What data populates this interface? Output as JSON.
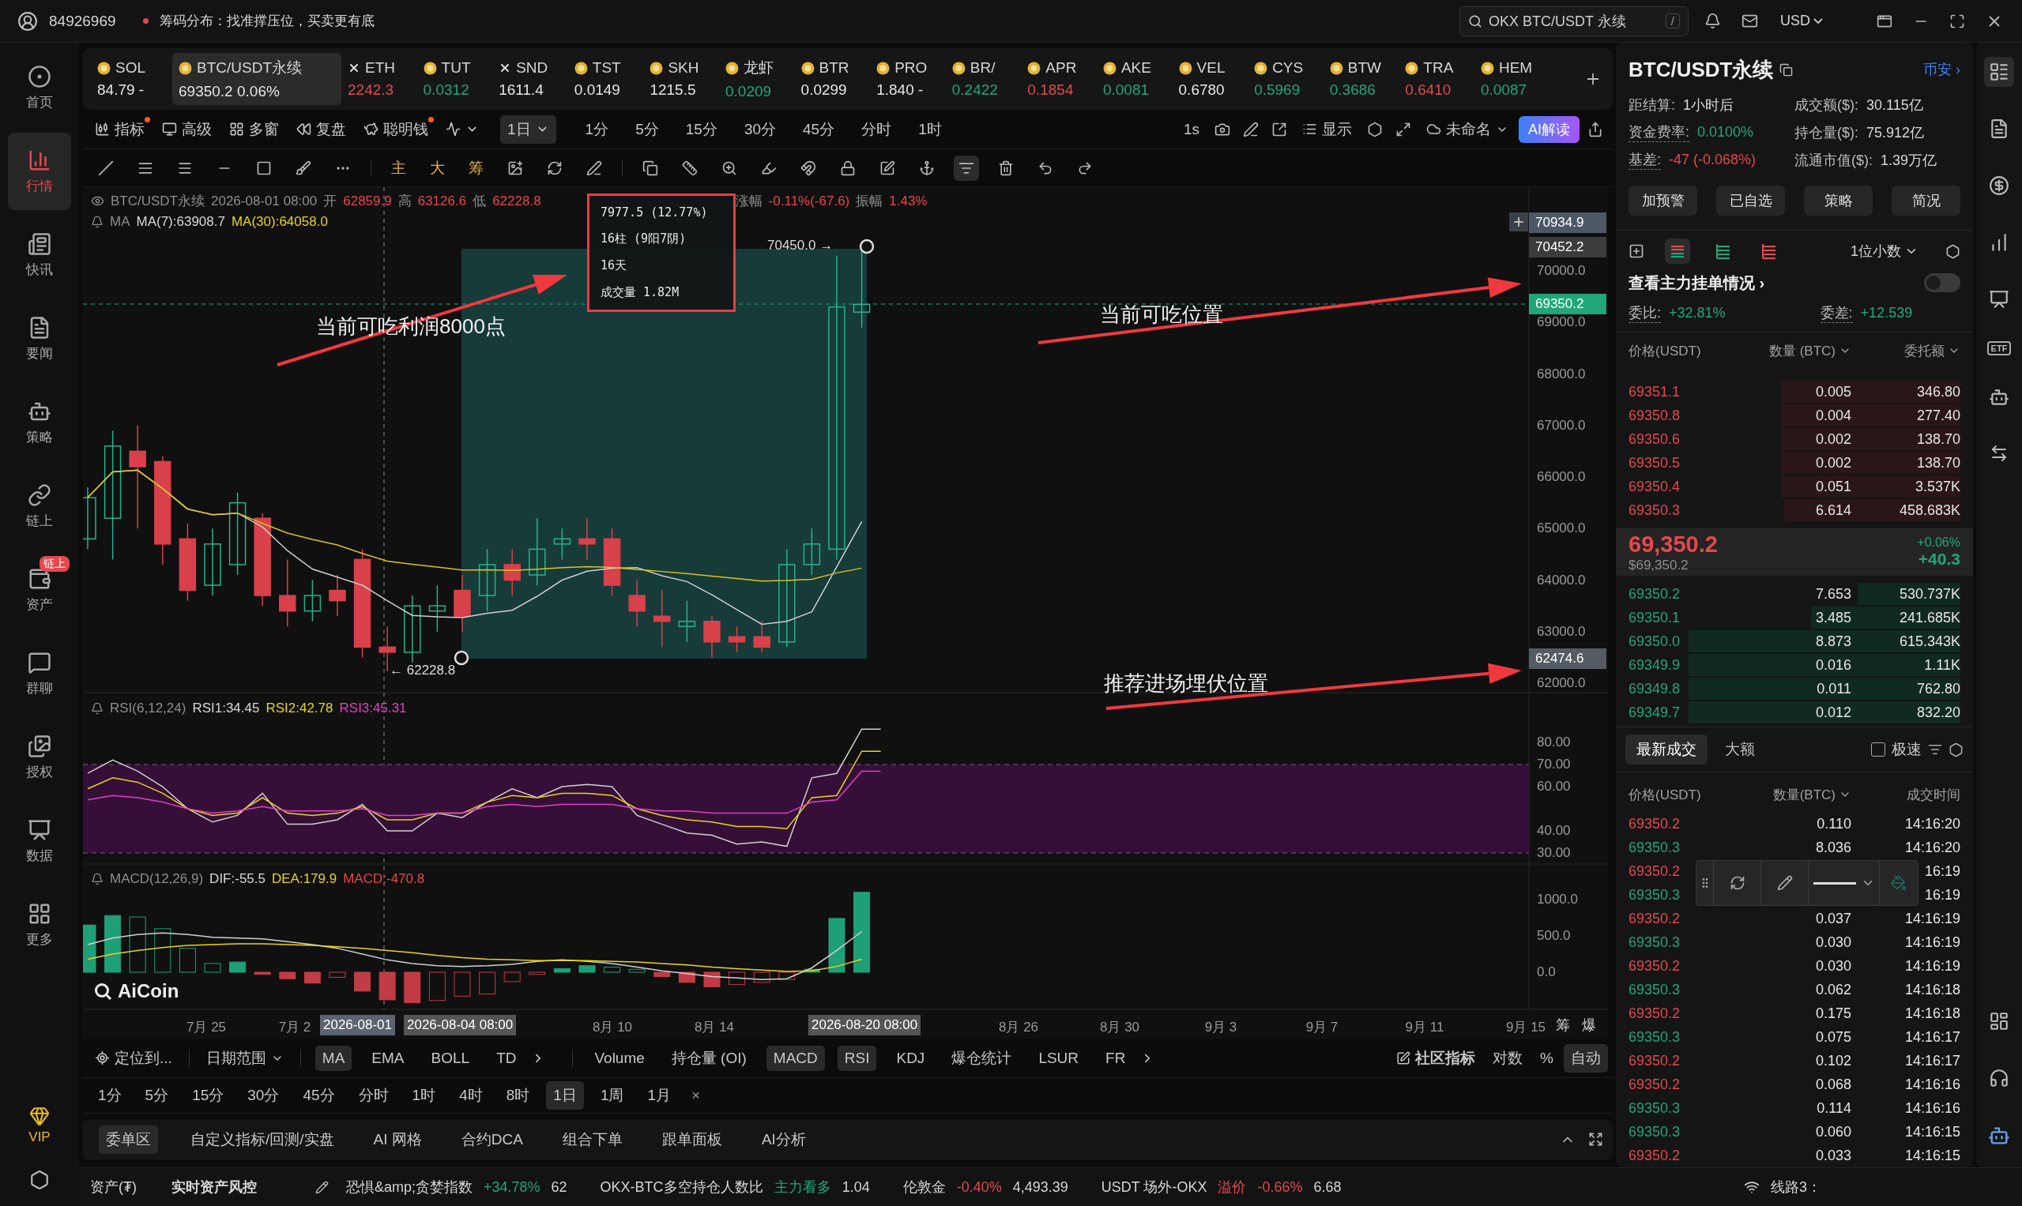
{
  "top_bar": {
    "user_id": "84926969",
    "notice": "筹码分布：找准撑压位，买卖更有底",
    "search": {
      "value": "OKX BTC/USDT 永续",
      "shortcut": "/"
    },
    "currency": "USD"
  },
  "sidebar": {
    "items": [
      {
        "label": "首页",
        "selected": false
      },
      {
        "label": "行情",
        "selected": true
      },
      {
        "label": "快讯",
        "selected": false
      },
      {
        "label": "要闻",
        "selected": false
      },
      {
        "label": "策略",
        "selected": false
      },
      {
        "label": "链上",
        "selected": false
      },
      {
        "label": "资产",
        "selected": false,
        "badge": "链上"
      },
      {
        "label": "群聊",
        "selected": false
      },
      {
        "label": "授权",
        "selected": false
      },
      {
        "label": "数据",
        "selected": false
      },
      {
        "label": "更多",
        "selected": false
      }
    ],
    "vip": "VIP"
  },
  "tickers": [
    {
      "symbol": "SOL",
      "price": "84.79",
      "change": "-",
      "color": "#e6e6e6",
      "selected": false,
      "kind": "coin"
    },
    {
      "symbol": "BTC/USDT永续",
      "price": "69350.2",
      "change": "0.06%",
      "color": "#e6e6e6",
      "selected": true,
      "kind": "coin"
    },
    {
      "symbol": "ETH",
      "price": "2242.3",
      "color": "#e5484d",
      "selected": false,
      "kind": "cross"
    },
    {
      "symbol": "TUT",
      "price": "0.0312",
      "color": "#21a67a",
      "selected": false,
      "kind": "coin"
    },
    {
      "symbol": "SND",
      "price": "1611.4",
      "color": "#e6e6e6",
      "selected": false,
      "kind": "cross"
    },
    {
      "symbol": "TST",
      "price": "0.0149",
      "color": "#e6e6e6",
      "selected": false,
      "kind": "coin"
    },
    {
      "symbol": "SKH",
      "price": "1215.5",
      "color": "#e6e6e6",
      "selected": false,
      "kind": "coin"
    },
    {
      "symbol": "龙虾",
      "price": "0.0209",
      "color": "#21a67a",
      "selected": false,
      "kind": "coin"
    },
    {
      "symbol": "BTR",
      "price": "0.0299",
      "color": "#e6e6e6",
      "selected": false,
      "kind": "coin"
    },
    {
      "symbol": "PRO",
      "price": "1.840",
      "change": "-",
      "color": "#e6e6e6",
      "selected": false,
      "kind": "coin"
    },
    {
      "symbol": "BR/",
      "price": "0.2422",
      "color": "#21a67a",
      "selected": false,
      "kind": "coin"
    },
    {
      "symbol": "APR",
      "price": "0.1854",
      "color": "#e5484d",
      "selected": false,
      "kind": "coin"
    },
    {
      "symbol": "AKE",
      "price": "0.0081",
      "color": "#21a67a",
      "selected": false,
      "kind": "coin"
    },
    {
      "symbol": "VEL",
      "price": "0.6780",
      "color": "#e6e6e6",
      "selected": false,
      "kind": "coin"
    },
    {
      "symbol": "CYS",
      "price": "0.5969",
      "color": "#21a67a",
      "selected": false,
      "kind": "coin"
    },
    {
      "symbol": "BTW",
      "price": "0.3686",
      "color": "#21a67a",
      "selected": false,
      "kind": "coin"
    },
    {
      "symbol": "TRA",
      "price": "0.6410",
      "color": "#e5484d",
      "selected": false,
      "kind": "coin"
    },
    {
      "symbol": "HEM",
      "price": "0.0087",
      "color": "#21a67a",
      "selected": false,
      "kind": "coin"
    }
  ],
  "chart_toolbar": {
    "tools": [
      {
        "label": "指标",
        "dot": true
      },
      {
        "label": "高级",
        "dot": false
      },
      {
        "label": "多窗",
        "dot": false
      },
      {
        "label": "复盘",
        "dot": false
      },
      {
        "label": "聪明钱",
        "dot": true
      }
    ],
    "intervals": [
      {
        "label": "1日",
        "selected": true
      },
      {
        "label": "1分",
        "selected": false
      },
      {
        "label": "5分",
        "selected": false
      },
      {
        "label": "15分",
        "selected": false
      },
      {
        "label": "30分",
        "selected": false
      },
      {
        "label": "45分",
        "selected": false
      },
      {
        "label": "分时",
        "selected": false
      },
      {
        "label": "1时",
        "selected": false
      }
    ],
    "speed": "1s",
    "display": "显示",
    "layout_name": "未命名",
    "ai_button": "AI解读"
  },
  "drawing_toolbar": {
    "text_tools": [
      "主",
      "大",
      "筹"
    ]
  },
  "chart": {
    "header": {
      "symbol": "BTC/USDT永续",
      "time": "2026-08-01 08:00",
      "fields": [
        {
          "label": "开",
          "value": "62859.9"
        },
        {
          "label": "高",
          "value": "63126.6"
        },
        {
          "label": "低",
          "value": "62228.8"
        },
        {
          "label": "涨幅",
          "value": "-0.11%(-67.6)"
        },
        {
          "label": "振幅",
          "value": "1.43%"
        }
      ]
    },
    "ma_legend": {
      "name": "MA",
      "items": [
        {
          "text": "MA(7):63908.7",
          "color": "#d8d8d8"
        },
        {
          "text": "MA(30):64058.0",
          "color": "#e8d41c"
        }
      ]
    },
    "measure": [
      "7977.5 (12.77%)",
      "16柱 (9阳7阴)",
      "16天",
      "成交量 1.82M"
    ],
    "high_marker": "70450.0 →",
    "low_marker": "← 62228.8",
    "annotations": [
      "当前可吃利润8000点",
      "当前可吃位置",
      "推荐进场埋伏位置"
    ],
    "price_axis": [
      "70000.0",
      "69000.0",
      "68000.0",
      "67000.0",
      "66000.0",
      "65000.0",
      "64000.0",
      "63000.0",
      "62000.0"
    ],
    "price_tags": [
      {
        "text": "70934.9",
        "kind": "crosshair"
      },
      {
        "text": "70452.2",
        "kind": "high"
      },
      {
        "text": "69350.2",
        "kind": "last"
      },
      {
        "text": "62474.6",
        "kind": "low"
      }
    ],
    "rsi": {
      "title": "RSI(6,12,24)",
      "values": [
        {
          "text": "RSI1:34.45",
          "color": "#d8d8d8"
        },
        {
          "text": "RSI2:42.78",
          "color": "#e8d41c"
        },
        {
          "text": "RSI3:45.31",
          "color": "#e040c8"
        }
      ],
      "axis": [
        "80.00",
        "70.00",
        "60.00",
        "40.00",
        "30.00"
      ]
    },
    "macd": {
      "title": "MACD(12,26,9)",
      "values": [
        {
          "text": "DIF:-55.5",
          "color": "#d8d8d8"
        },
        {
          "text": "DEA:179.9",
          "color": "#e8d41c"
        },
        {
          "text": "MACD:-470.8",
          "color": "#e5484d"
        }
      ],
      "axis": [
        "1000.0",
        "500.0",
        "0.0"
      ]
    },
    "logo": "AiCoin",
    "x_axis": {
      "labels": [
        "7月 25",
        "7月 2",
        "8月 10",
        "8月 14",
        "8月 26",
        "8月 30",
        "9月 3",
        "9月 7",
        "9月 11",
        "9月 15"
      ],
      "cursor_tags": [
        "2026-08-01",
        "2026-08-04 08:00",
        "2026-08-20 08:00"
      ],
      "buttons": [
        "筹",
        "爆"
      ]
    }
  },
  "indicator_bar": {
    "locate": "定位到...",
    "date_range": "日期范围",
    "main": [
      {
        "label": "MA",
        "selected": true
      },
      {
        "label": "EMA",
        "selected": false
      },
      {
        "label": "BOLL",
        "selected": false
      },
      {
        "label": "TD",
        "selected": false
      }
    ],
    "sub": [
      {
        "label": "Volume",
        "selected": false
      },
      {
        "label": "持仓量 (OI)",
        "selected": false
      },
      {
        "label": "MACD",
        "selected": true
      },
      {
        "label": "RSI",
        "selected": true
      },
      {
        "label": "KDJ",
        "selected": false
      },
      {
        "label": "爆仓统计",
        "selected": false
      },
      {
        "label": "LSUR",
        "selected": false
      },
      {
        "label": "FR",
        "selected": false
      }
    ],
    "community": "社区指标",
    "options": [
      {
        "label": "对数",
        "selected": false
      },
      {
        "label": "%",
        "selected": false
      },
      {
        "label": "自动",
        "selected": true
      }
    ]
  },
  "interval_bar": {
    "items": [
      {
        "label": "1分",
        "selected": false
      },
      {
        "label": "5分",
        "selected": false
      },
      {
        "label": "15分",
        "selected": false
      },
      {
        "label": "30分",
        "selected": false
      },
      {
        "label": "45分",
        "selected": false
      },
      {
        "label": "分时",
        "selected": false
      },
      {
        "label": "1时",
        "selected": false
      },
      {
        "label": "4时",
        "selected": false
      },
      {
        "label": "8时",
        "selected": false
      },
      {
        "label": "1日",
        "selected": true
      },
      {
        "label": "1周",
        "selected": false
      },
      {
        "label": "1月",
        "selected": false
      }
    ],
    "close": "×"
  },
  "bottom_tabs": [
    {
      "label": "委单区",
      "selected": true
    },
    {
      "label": "自定义指标/回测/实盘",
      "selected": false
    },
    {
      "label": "AI 网格",
      "selected": false
    },
    {
      "label": "合约DCA",
      "selected": false
    },
    {
      "label": "组合下单",
      "selected": false
    },
    {
      "label": "跟单面板",
      "selected": false
    },
    {
      "label": "AI分析",
      "selected": false
    }
  ],
  "market": {
    "title": "BTC/USDT永续",
    "exchange": "币安",
    "exchange_arrow": "›",
    "stats": [
      {
        "label": "距结算:",
        "value": "1小时后",
        "color": "#d8d8d8"
      },
      {
        "label": "成交额($):",
        "value": "30.115亿",
        "color": "#d8d8d8"
      },
      {
        "label": "资金费率:",
        "value": "0.0100%",
        "color": "#21a67a"
      },
      {
        "label": "持仓量($):",
        "value": "75.912亿",
        "color": "#d8d8d8"
      },
      {
        "label": "基差:",
        "value": "-47 (-0.068%)",
        "color": "#e5484d"
      },
      {
        "label": "流通市值($):",
        "value": "1.39万亿",
        "color": "#d8d8d8"
      }
    ],
    "actions": [
      "加预警",
      "已自选",
      "策略",
      "简况"
    ]
  },
  "orderbook": {
    "view_modes": [
      {
        "kind": "both",
        "selected": true
      },
      {
        "kind": "bids",
        "selected": false
      },
      {
        "kind": "asks",
        "selected": false
      }
    ],
    "precision": "1位小数",
    "main_orders": {
      "label": "查看主力挂单情况",
      "arrow": "›",
      "on": false
    },
    "ratio": {
      "label": "委比:",
      "value": "+32.81%"
    },
    "diff": {
      "label": "委差:",
      "value": "+12.539"
    },
    "columns": [
      "价格(USDT)",
      "数量 (BTC)",
      "委托额"
    ],
    "asks": [
      {
        "price": "69351.1",
        "qty": "0.005",
        "amount": "346.80",
        "level": 0.54
      },
      {
        "price": "69350.8",
        "qty": "0.004",
        "amount": "277.40",
        "level": 0.54
      },
      {
        "price": "69350.6",
        "qty": "0.002",
        "amount": "138.70",
        "level": 0.54
      },
      {
        "price": "69350.5",
        "qty": "0.002",
        "amount": "138.70",
        "level": 0.54
      },
      {
        "price": "69350.4",
        "qty": "0.051",
        "amount": "3.537K",
        "level": 0.54
      },
      {
        "price": "69350.3",
        "qty": "6.614",
        "amount": "458.683K",
        "level": 0.53
      }
    ],
    "last": {
      "price": "69,350.2",
      "usd": "$69,350.2",
      "pct": "+0.06%",
      "change": "+40.3"
    },
    "bids": [
      {
        "price": "69350.2",
        "qty": "7.653",
        "amount": "530.737K",
        "level": 0.31
      },
      {
        "price": "69350.1",
        "qty": "3.485",
        "amount": "241.685K",
        "level": 0.45
      },
      {
        "price": "69350.0",
        "qty": "8.873",
        "amount": "615.343K",
        "level": 0.82
      },
      {
        "price": "69349.9",
        "qty": "0.016",
        "amount": "1.11K",
        "level": 0.82
      },
      {
        "price": "69349.8",
        "qty": "0.011",
        "amount": "762.80",
        "level": 0.82
      },
      {
        "price": "69349.7",
        "qty": "0.012",
        "amount": "832.20",
        "level": 0.82
      }
    ]
  },
  "trades": {
    "tabs": [
      {
        "label": "最新成交",
        "selected": true
      },
      {
        "label": "大额",
        "selected": false
      }
    ],
    "fast": {
      "label": "极速",
      "checked": false
    },
    "columns": [
      "价格(USDT)",
      "数量(BTC)",
      "成交时间"
    ],
    "rows": [
      {
        "price": "69350.2",
        "qty": "0.110",
        "time": "14:16:20",
        "color": "#e5484d"
      },
      {
        "price": "69350.3",
        "qty": "8.036",
        "time": "14:16:20",
        "color": "#21a67a"
      },
      {
        "price": "69350.2",
        "time": "16:19",
        "color": "#e5484d"
      },
      {
        "price": "69350.3",
        "time": "16:19",
        "color": "#21a67a"
      },
      {
        "price": "69350.2",
        "qty": "0.037",
        "time": "14:16:19",
        "color": "#e5484d"
      },
      {
        "price": "69350.3",
        "qty": "0.030",
        "time": "14:16:19",
        "color": "#21a67a"
      },
      {
        "price": "69350.2",
        "qty": "0.030",
        "time": "14:16:19",
        "color": "#e5484d"
      },
      {
        "price": "69350.3",
        "qty": "0.062",
        "time": "14:16:18",
        "color": "#21a67a"
      },
      {
        "price": "69350.2",
        "qty": "0.175",
        "time": "14:16:18",
        "color": "#e5484d"
      },
      {
        "price": "69350.3",
        "qty": "0.075",
        "time": "14:16:17",
        "color": "#21a67a"
      },
      {
        "price": "69350.2",
        "qty": "0.102",
        "time": "14:16:17",
        "color": "#e5484d"
      },
      {
        "price": "69350.2",
        "qty": "0.068",
        "time": "14:16:16",
        "color": "#e5484d"
      },
      {
        "price": "69350.3",
        "qty": "0.114",
        "time": "14:16:16",
        "color": "#21a67a"
      },
      {
        "price": "69350.3",
        "qty": "0.060",
        "time": "14:16:15",
        "color": "#21a67a"
      },
      {
        "price": "69350.2",
        "qty": "0.033",
        "time": "14:16:15",
        "color": "#e5484d"
      }
    ]
  },
  "side_rail": {
    "etf_label": "ETF"
  },
  "status_bar": {
    "asset": "资产(₮)",
    "risk": "实时资产风控",
    "indices": [
      {
        "name": "恐惧&amp;贪婪指数",
        "change": "+34.78%",
        "color": "#21a67a",
        "value": "62"
      },
      {
        "name": "OKX-BTC多空持仓人数比",
        "change": "主力看多",
        "color": "#21a67a",
        "value": "1.04"
      },
      {
        "name": "伦敦金",
        "change": "-0.40%",
        "color": "#e5484d",
        "value": "4,493.39"
      },
      {
        "name": "USDT 场外-OKX",
        "tag": "溢价",
        "change": "-0.66%",
        "color": "#e5484d",
        "value": "6.68"
      }
    ],
    "line": "线路3："
  }
}
